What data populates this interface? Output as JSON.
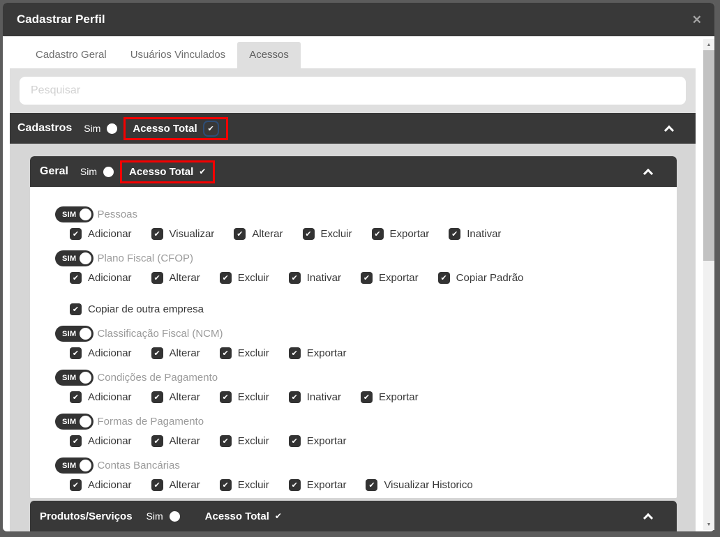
{
  "modal": {
    "title": "Cadastrar Perfil",
    "close_glyph": "✕"
  },
  "tabs": [
    {
      "label": "Cadastro Geral",
      "active": false
    },
    {
      "label": "Usuários Vinculados",
      "active": false
    },
    {
      "label": "Acessos",
      "active": true
    }
  ],
  "search": {
    "placeholder": "Pesquisar"
  },
  "icons": {
    "check": "✔",
    "scroll_up": "▲",
    "scroll_down": "▼"
  },
  "sections": {
    "cadastros": {
      "title": "Cadastros",
      "sim_label": "Sim",
      "access_label": "Acesso Total",
      "access_checked": true,
      "highlighted": true
    },
    "geral": {
      "title": "Geral",
      "sim_label": "Sim",
      "access_label": "Acesso Total",
      "access_checked": true,
      "highlighted": true
    },
    "produtos_servicos": {
      "title": "Produtos/Serviços",
      "sim_label": "Sim",
      "access_label": "Acesso Total",
      "access_checked": true,
      "highlighted": false
    }
  },
  "groups": [
    {
      "toggle_label": "SIM",
      "enabled": true,
      "label": "Pessoas",
      "permissions": [
        "Adicionar",
        "Visualizar",
        "Alterar",
        "Excluir",
        "Exportar",
        "Inativar"
      ]
    },
    {
      "toggle_label": "SIM",
      "enabled": true,
      "label": "Plano Fiscal (CFOP)",
      "permissions": [
        "Adicionar",
        "Alterar",
        "Excluir",
        "Inativar",
        "Exportar",
        "Copiar Padrão",
        "Copiar de outra empresa"
      ]
    },
    {
      "toggle_label": "SIM",
      "enabled": true,
      "label": "Classificação Fiscal (NCM)",
      "permissions": [
        "Adicionar",
        "Alterar",
        "Excluir",
        "Exportar"
      ]
    },
    {
      "toggle_label": "SIM",
      "enabled": true,
      "label": "Condições de Pagamento",
      "permissions": [
        "Adicionar",
        "Alterar",
        "Excluir",
        "Inativar",
        "Exportar"
      ]
    },
    {
      "toggle_label": "SIM",
      "enabled": true,
      "label": "Formas de Pagamento",
      "permissions": [
        "Adicionar",
        "Alterar",
        "Excluir",
        "Exportar"
      ]
    },
    {
      "toggle_label": "SIM",
      "enabled": true,
      "label": "Contas Bancárias",
      "permissions": [
        "Adicionar",
        "Alterar",
        "Excluir",
        "Exportar",
        "Visualizar Historico"
      ]
    }
  ],
  "colors": {
    "bar_bg": "#383838",
    "highlight_red": "#f40000",
    "checkbox_dark": "#333333",
    "focus_ring_blue": "#2e4d75",
    "panel_gray": "#dcdcdc",
    "section_gray": "#d6d6d6",
    "backdrop": "#5c5c5c"
  }
}
